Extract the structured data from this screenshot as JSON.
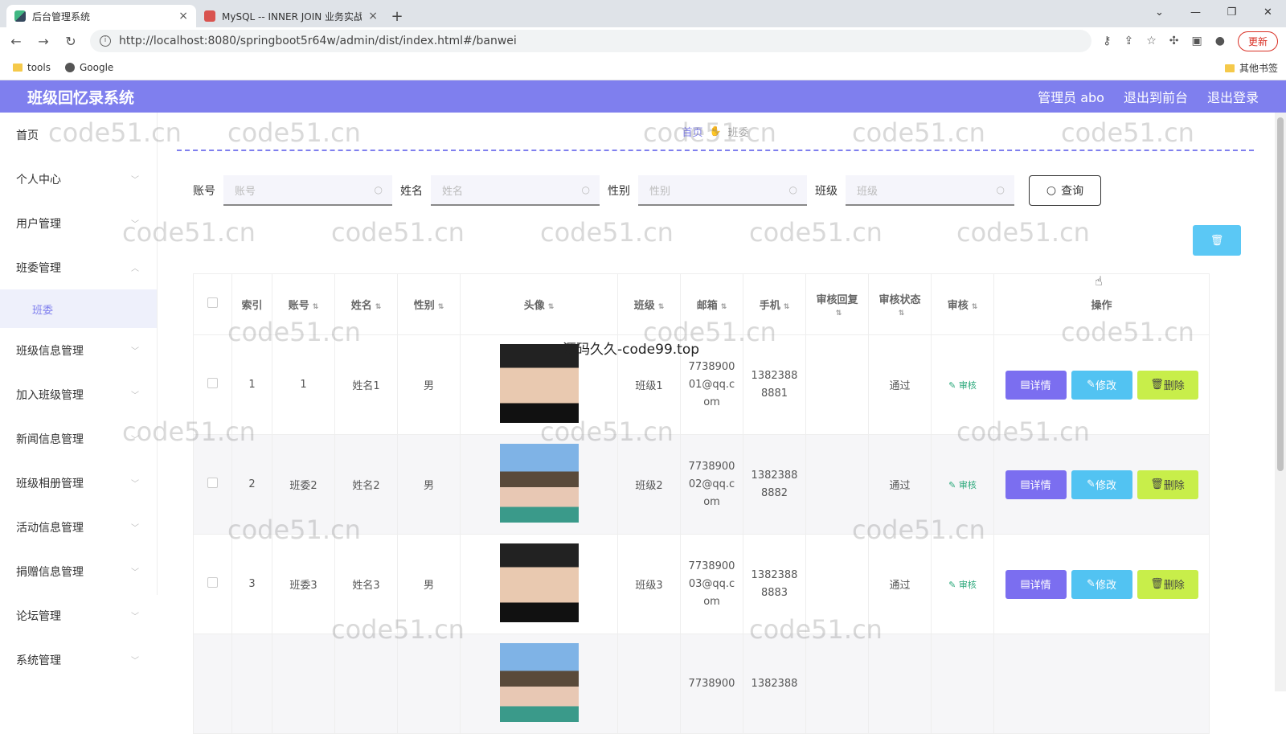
{
  "browser": {
    "tabs": [
      {
        "title": "后台管理系统",
        "close": "×"
      },
      {
        "title": "MySQL -- INNER JOIN 业务实战",
        "close": "×"
      }
    ],
    "new_tab": "+",
    "url": "http://localhost:8080/springboot5r64w/admin/dist/index.html#/banwei",
    "update_label": "更新",
    "bookmarks": [
      "tools",
      "Google"
    ],
    "other_bookmarks": "其他书签"
  },
  "app": {
    "title": "班级回忆录系统",
    "header_links": [
      "管理员 abo",
      "退出到前台",
      "退出登录"
    ]
  },
  "sidebar": {
    "items": [
      {
        "label": "首页"
      },
      {
        "label": "个人中心"
      },
      {
        "label": "用户管理"
      },
      {
        "label": "班委管理"
      },
      {
        "label": "班委",
        "sub": true
      },
      {
        "label": "班级信息管理"
      },
      {
        "label": "加入班级管理"
      },
      {
        "label": "新闻信息管理"
      },
      {
        "label": "班级相册管理"
      },
      {
        "label": "活动信息管理"
      },
      {
        "label": "捐赠信息管理"
      },
      {
        "label": "论坛管理"
      },
      {
        "label": "系统管理"
      }
    ]
  },
  "breadcrumb": {
    "home": "首页",
    "current": "班委"
  },
  "search": {
    "fields": [
      {
        "label": "账号",
        "placeholder": "账号"
      },
      {
        "label": "姓名",
        "placeholder": "姓名"
      },
      {
        "label": "性别",
        "placeholder": "性别"
      },
      {
        "label": "班级",
        "placeholder": "班级"
      }
    ],
    "query_label": "查询"
  },
  "table": {
    "headers": [
      "索引",
      "账号",
      "姓名",
      "性别",
      "头像",
      "班级",
      "邮箱",
      "手机",
      "审核回复",
      "审核状态",
      "审核",
      "操作"
    ],
    "rows": [
      {
        "index": "1",
        "account": "1",
        "name": "姓名1",
        "gender": "男",
        "avatar": "male",
        "class": "班级1",
        "email": "773890001@qq.com",
        "phone": "13823888881",
        "reply": "",
        "status": "通过",
        "audit": "审核"
      },
      {
        "index": "2",
        "account": "班委2",
        "name": "姓名2",
        "gender": "男",
        "avatar": "female",
        "class": "班级2",
        "email": "773890002@qq.com",
        "phone": "13823888882",
        "reply": "",
        "status": "通过",
        "audit": "审核"
      },
      {
        "index": "3",
        "account": "班委3",
        "name": "姓名3",
        "gender": "男",
        "avatar": "male",
        "class": "班级3",
        "email": "773890003@qq.com",
        "phone": "13823888883",
        "reply": "",
        "status": "通过",
        "audit": "审核"
      }
    ],
    "partial_row": {
      "email": "7738900",
      "phone": "1382388"
    },
    "actions": {
      "detail": "详情",
      "edit": "修改",
      "delete": "删除"
    }
  },
  "watermark": "code51.cn",
  "overlay_text": "源码久久-code99.top"
}
